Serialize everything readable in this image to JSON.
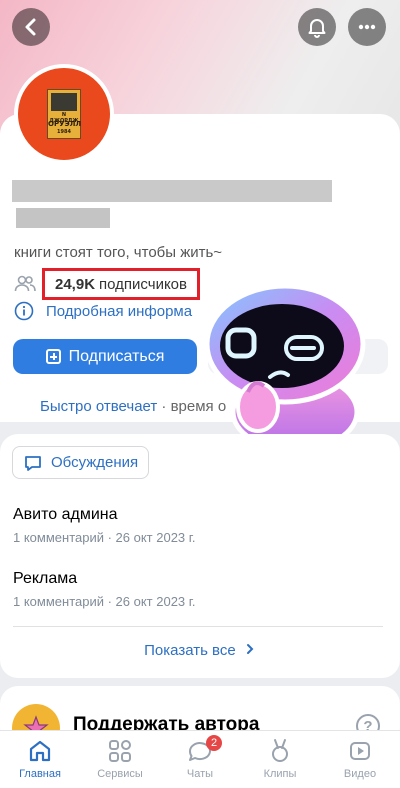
{
  "profile": {
    "avatar_book": {
      "line1": "N ДЖОРДЖ",
      "line2": "ОРУЭЛЛ",
      "line3": "1984"
    },
    "status": "книги стоят того, чтобы жить~",
    "subscribers_count": "24,9K",
    "subscribers_label": "подписчиков",
    "details_link": "Подробная информа",
    "subscribe_button": "Подписаться",
    "reply_speed": "Быстро отвечает",
    "reply_time_label": " · время о"
  },
  "discussions": {
    "button_label": "Обсуждения",
    "topics": [
      {
        "title": "Авито админа",
        "meta": "1 комментарий · 26 окт 2023 г."
      },
      {
        "title": "Реклама",
        "meta": "1 комментарий · 26 окт 2023 г."
      }
    ],
    "show_all": "Показать все"
  },
  "support": {
    "title": "Поддержать автора",
    "help": "?"
  },
  "tabbar": {
    "tabs": [
      {
        "label": "Главная"
      },
      {
        "label": "Сервисы"
      },
      {
        "label": "Чаты",
        "badge": "2"
      },
      {
        "label": "Клипы"
      },
      {
        "label": "Видео"
      }
    ]
  },
  "colors": {
    "accent": "#2f7de1",
    "highlight_border": "#e1202a",
    "badge": "#e64646"
  },
  "icons": [
    "back-icon",
    "bell-icon",
    "more-icon",
    "people-icon",
    "info-icon",
    "plus-icon",
    "chat-bubble-icon",
    "chevron-right-icon",
    "star-icon",
    "help-icon",
    "home-icon",
    "services-icon",
    "chats-icon",
    "clips-icon",
    "video-icon"
  ]
}
